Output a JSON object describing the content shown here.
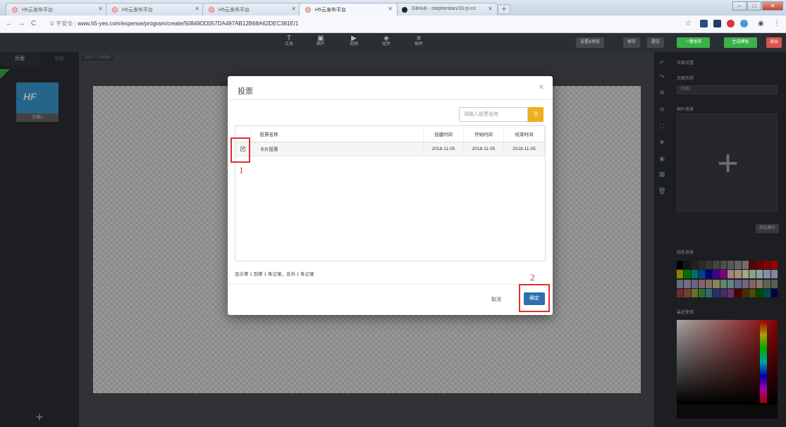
{
  "browser": {
    "tabs": [
      {
        "title": "H5云发布平台",
        "active": false
      },
      {
        "title": "H5云发布平台",
        "active": false
      },
      {
        "title": "H5云发布平台",
        "active": false
      },
      {
        "title": "H5云发布平台",
        "active": true
      },
      {
        "title": "GitHub - stephentian/33-js-co",
        "active": false
      }
    ],
    "url_security": "① 不安全",
    "url": "www.h5-yes.com/expense/program/create/50849DD057DA497AB12B68A62DEC381E/1"
  },
  "toolbar": {
    "tools": [
      {
        "label": "文本",
        "icon": "T"
      },
      {
        "label": "图片",
        "icon": "▣"
      },
      {
        "label": "视频",
        "icon": "▶"
      },
      {
        "label": "组件",
        "icon": "◈"
      },
      {
        "label": "插件",
        "icon": "≡"
      }
    ],
    "buttons": [
      "设置&预览",
      "保存",
      "提交"
    ],
    "publish": "一键发布",
    "generate": "生成模板",
    "exit": "退出"
  },
  "left_panel": {
    "tab_pages": "页面",
    "tab_popups": "弹窗",
    "page_label": "页面1",
    "logo": "HF"
  },
  "workspace": {
    "size_label": "1920 * 1080px"
  },
  "right_panel": {
    "title": "页面设置",
    "name_label": "页面名称",
    "name_value": "页面1",
    "bg_image_label": "图片背景",
    "add_image": "添加图片",
    "solid_bg_label": "纯色背景",
    "recent_label": "最近使用"
  },
  "modal": {
    "title": "投票",
    "search_placeholder": "请输入投票名称",
    "columns": [
      "投票名称",
      "创建时间",
      "开始时间",
      "结束时间"
    ],
    "rows": [
      {
        "name": "卡片投票",
        "created": "2018-11-05",
        "start": "2018-11-05",
        "end": "2018-11-05",
        "checked": true
      }
    ],
    "footer": "显示第 1 到第 1 条记录，总共 1 条记录",
    "cancel": "取消",
    "ok": "确定"
  },
  "annotations": {
    "marker1": "1",
    "marker2": "2"
  },
  "colors": {
    "accent_green": "#3ab14a",
    "confirm_blue": "#2f6fad",
    "search_orange": "#f0ad1e",
    "annotation_red": "#e03030"
  }
}
